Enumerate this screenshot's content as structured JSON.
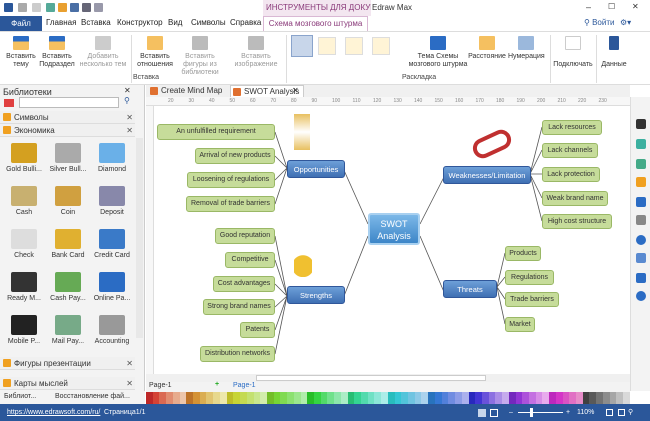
{
  "window": {
    "context_tab_title": "ИНСТРУМЕНТЫ ДЛЯ ДОКУМЕН...",
    "app_title": "Edraw Max",
    "minimize": "–",
    "maximize": "☐",
    "close": "✕"
  },
  "menu": {
    "file": "Файл",
    "items": [
      "Главная",
      "Вставка",
      "Конструктор",
      "Вид",
      "Символы",
      "Справка"
    ],
    "context": "Схема мозгового штурма",
    "login": "Войти"
  },
  "ribbon": {
    "buttons": [
      {
        "label": "Вставить тему"
      },
      {
        "label": "Вставить Подраздел"
      },
      {
        "label": "Добавить несколько тем"
      },
      {
        "label": "Вставить отношения"
      },
      {
        "label": "Вставить фигуры из библиотеки"
      },
      {
        "label": "Вставить изображение"
      },
      {
        "label": "Тема Схемы мозгового штурма"
      },
      {
        "label": "Расстояние"
      },
      {
        "label": "Нумерация"
      },
      {
        "label": "Подключать"
      },
      {
        "label": "Данные"
      }
    ],
    "groups": {
      "insert": "Вставка",
      "layout": "Раскладка"
    }
  },
  "libraries": {
    "title": "Библиотеки",
    "search_placeholder": "",
    "sections": [
      "Символы",
      "Экономика",
      "Фигуры презентации",
      "Карты мыслей"
    ],
    "items": [
      "Gold Bulli...",
      "Silver Bull...",
      "Diamond",
      "Cash",
      "Coin",
      "Deposit",
      "Check",
      "Bank Card",
      "Credit Card",
      "Ready M...",
      "Cash Pay...",
      "Online Pa...",
      "Mobile P...",
      "Mail Pay...",
      "Accounting"
    ],
    "bottom_tabs": [
      "Библиот...",
      "Восстановление фай..."
    ]
  },
  "doc_tabs": [
    "Create Mind Map Fl...",
    "SWOT Analysis"
  ],
  "ruler": [
    "20",
    "30",
    "40",
    "50",
    "60",
    "70",
    "80",
    "90",
    "100",
    "110",
    "120",
    "130",
    "140",
    "150",
    "160",
    "170",
    "180",
    "190",
    "200",
    "210",
    "220",
    "230"
  ],
  "mindmap": {
    "center": [
      "SWOT",
      "Analysis"
    ],
    "opportunities": {
      "label": "Opportunities",
      "items": [
        "An unfulfilled requirement",
        "Arrival of new products",
        "Loosening of regulations",
        "Removal of trade barriers"
      ]
    },
    "strengths": {
      "label": "Strengths",
      "items": [
        "Good reputation",
        "Competitive",
        "Cost advantages",
        "Strong brand names",
        "Patents",
        "Distribution networks"
      ]
    },
    "weaknesses": {
      "label": "Weaknesses/Limitation",
      "items": [
        "Lack resources",
        "Lack channels",
        "Lack protection",
        "Weak brand name",
        "High cost structure"
      ]
    },
    "threats": {
      "label": "Threats",
      "items": [
        "Products",
        "Regulations",
        "Trade barriers",
        "Market"
      ]
    }
  },
  "pages": {
    "tab": "Page-1",
    "active": "Page-1",
    "add": "+"
  },
  "status": {
    "url": "https://www.edrawsoft.com/ru/",
    "page": "Страница1/1",
    "zoom": "110%"
  }
}
